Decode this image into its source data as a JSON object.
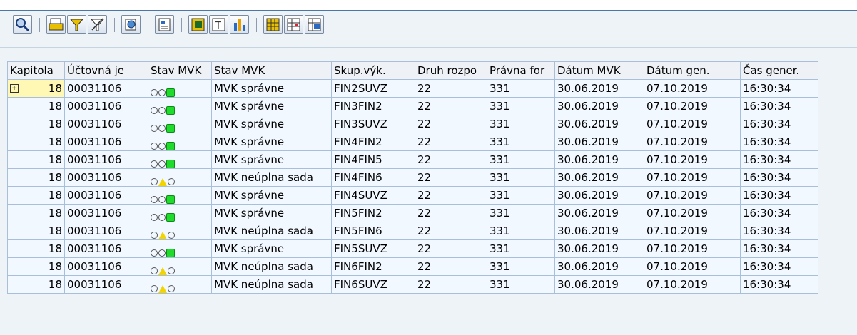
{
  "toolbar": {
    "buttons": [
      "details-icon",
      "print-icon",
      "filter-icon",
      "delete-filter-icon",
      "export-icon",
      "spreadsheet-icon",
      "local-file-icon",
      "word-icon",
      "graphics-icon",
      "layout-icon",
      "change-layout-icon",
      "save-layout-icon"
    ]
  },
  "table": {
    "headers": [
      "Kapitola",
      "Účtovná je",
      "Stav MVK",
      "Stav MVK",
      "Skup.výk.",
      "Druh rozpo",
      "Právna for",
      "Dátum MVK",
      "Dátum gen.",
      "Čas gener."
    ],
    "rows": [
      {
        "kapitola": "18",
        "uctovna": "00031106",
        "light": "green",
        "stav": "MVK správne",
        "skup": "FIN2SUVZ",
        "druh": "22",
        "pravna": "331",
        "datum_mvk": "30.06.2019",
        "datum_gen": "07.10.2019",
        "cas": "16:30:34"
      },
      {
        "kapitola": "18",
        "uctovna": "00031106",
        "light": "green",
        "stav": "MVK správne",
        "skup": "FIN3FIN2",
        "druh": "22",
        "pravna": "331",
        "datum_mvk": "30.06.2019",
        "datum_gen": "07.10.2019",
        "cas": "16:30:34"
      },
      {
        "kapitola": "18",
        "uctovna": "00031106",
        "light": "green",
        "stav": "MVK správne",
        "skup": "FIN3SUVZ",
        "druh": "22",
        "pravna": "331",
        "datum_mvk": "30.06.2019",
        "datum_gen": "07.10.2019",
        "cas": "16:30:34"
      },
      {
        "kapitola": "18",
        "uctovna": "00031106",
        "light": "green",
        "stav": "MVK správne",
        "skup": "FIN4FIN2",
        "druh": "22",
        "pravna": "331",
        "datum_mvk": "30.06.2019",
        "datum_gen": "07.10.2019",
        "cas": "16:30:34"
      },
      {
        "kapitola": "18",
        "uctovna": "00031106",
        "light": "green",
        "stav": "MVK správne",
        "skup": "FIN4FIN5",
        "druh": "22",
        "pravna": "331",
        "datum_mvk": "30.06.2019",
        "datum_gen": "07.10.2019",
        "cas": "16:30:34"
      },
      {
        "kapitola": "18",
        "uctovna": "00031106",
        "light": "yellow",
        "stav": "MVK neúplna sada",
        "skup": "FIN4FIN6",
        "druh": "22",
        "pravna": "331",
        "datum_mvk": "30.06.2019",
        "datum_gen": "07.10.2019",
        "cas": "16:30:34"
      },
      {
        "kapitola": "18",
        "uctovna": "00031106",
        "light": "green",
        "stav": "MVK správne",
        "skup": "FIN4SUVZ",
        "druh": "22",
        "pravna": "331",
        "datum_mvk": "30.06.2019",
        "datum_gen": "07.10.2019",
        "cas": "16:30:34"
      },
      {
        "kapitola": "18",
        "uctovna": "00031106",
        "light": "green",
        "stav": "MVK správne",
        "skup": "FIN5FIN2",
        "druh": "22",
        "pravna": "331",
        "datum_mvk": "30.06.2019",
        "datum_gen": "07.10.2019",
        "cas": "16:30:34"
      },
      {
        "kapitola": "18",
        "uctovna": "00031106",
        "light": "yellow",
        "stav": "MVK neúplna sada",
        "skup": "FIN5FIN6",
        "druh": "22",
        "pravna": "331",
        "datum_mvk": "30.06.2019",
        "datum_gen": "07.10.2019",
        "cas": "16:30:34"
      },
      {
        "kapitola": "18",
        "uctovna": "00031106",
        "light": "green",
        "stav": "MVK správne",
        "skup": "FIN5SUVZ",
        "druh": "22",
        "pravna": "331",
        "datum_mvk": "30.06.2019",
        "datum_gen": "07.10.2019",
        "cas": "16:30:34"
      },
      {
        "kapitola": "18",
        "uctovna": "00031106",
        "light": "yellow",
        "stav": "MVK neúplna sada",
        "skup": "FIN6FIN2",
        "druh": "22",
        "pravna": "331",
        "datum_mvk": "30.06.2019",
        "datum_gen": "07.10.2019",
        "cas": "16:30:34"
      },
      {
        "kapitola": "18",
        "uctovna": "00031106",
        "light": "yellow",
        "stav": "MVK neúplna sada",
        "skup": "FIN6SUVZ",
        "druh": "22",
        "pravna": "331",
        "datum_mvk": "30.06.2019",
        "datum_gen": "07.10.2019",
        "cas": "16:30:34"
      }
    ]
  }
}
